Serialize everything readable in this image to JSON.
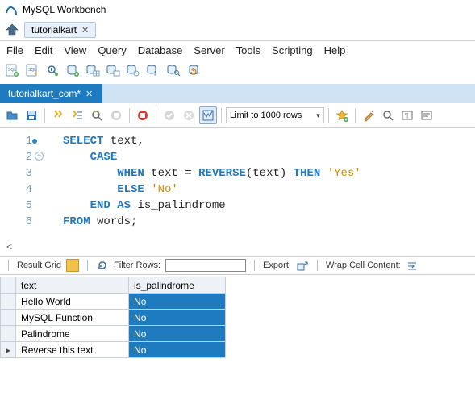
{
  "app": {
    "title": "MySQL Workbench"
  },
  "topTab": {
    "label": "tutorialkart"
  },
  "menu": {
    "file": "File",
    "edit": "Edit",
    "view": "View",
    "query": "Query",
    "database": "Database",
    "server": "Server",
    "tools": "Tools",
    "scripting": "Scripting",
    "help": "Help"
  },
  "fileTab": {
    "label": "tutorialkart_com*"
  },
  "queryToolbar": {
    "limit": "Limit to 1000 rows"
  },
  "sql": {
    "l1_kw": "SELECT",
    "l1_rest": " text",
    "l1_comma": ",",
    "l2_kw": "CASE",
    "l3_kw1": "WHEN",
    "l3_mid": " text ",
    "l3_eq": "=",
    "l3_fn": " REVERSE",
    "l3_args": "(text) ",
    "l3_kw2": "THEN",
    "l3_str": " 'Yes'",
    "l4_kw": "ELSE",
    "l4_str": " 'No'",
    "l5_kw1": "END",
    "l5_kw2": " AS",
    "l5_rest": " is_palindrome",
    "l6_kw": "FROM",
    "l6_rest": " words",
    "l6_semi": ";",
    "ln1": "1",
    "ln2": "2",
    "ln3": "3",
    "ln4": "4",
    "ln5": "5",
    "ln6": "6"
  },
  "scrollHint": "<",
  "resultsBar": {
    "resultGrid": "Result Grid",
    "filterRows": "Filter Rows:",
    "export": "Export:",
    "wrap": "Wrap Cell Content:"
  },
  "grid": {
    "col1": "text",
    "col2": "is_palindrome",
    "rows": [
      {
        "text": "Hello World",
        "pal": "No"
      },
      {
        "text": "MySQL Function",
        "pal": "No"
      },
      {
        "text": "Palindrome",
        "pal": "No"
      },
      {
        "text": "Reverse this text",
        "pal": "No"
      }
    ],
    "marker": "▸"
  }
}
